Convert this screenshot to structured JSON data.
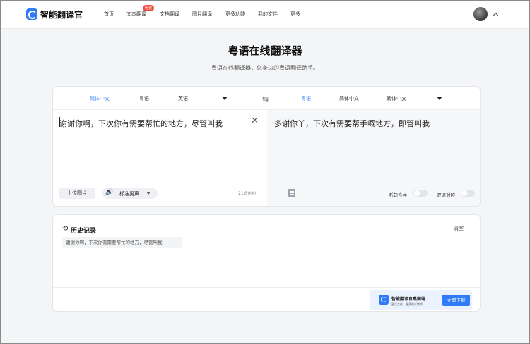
{
  "app": {
    "name": "智能翻译官"
  },
  "nav": {
    "items": [
      "首页",
      "文本翻译",
      "文档翻译",
      "图片翻译",
      "更多功能",
      "我的文件",
      "更多"
    ],
    "badge": "免费"
  },
  "hero": {
    "title": "粤语在线翻译器",
    "subtitle": "粤语在线翻译器，您身边的粤语翻译助手。"
  },
  "languages": {
    "source": [
      "简体中文",
      "粤语",
      "英语"
    ],
    "source_selected": "简体中文",
    "target": [
      "粤语",
      "简体中文",
      "繁体中文"
    ],
    "target_selected": "粤语"
  },
  "source": {
    "text": "谢谢你啊，下次你有需要帮忙的地方，尽管叫我",
    "upload_label": "上传图片",
    "voice_label": "标准男声",
    "char_count": "21/5000"
  },
  "target": {
    "text": "多谢你丫，下次有需要帮手嘅地方，即管叫我",
    "merge_label": "断句合并",
    "bilingual_label": "双语对照",
    "merge_on": false,
    "bilingual_on": false
  },
  "history": {
    "title": "历史记录",
    "clear_label": "清空",
    "items": [
      "谢谢你啊，下次你有需要帮忙的地方，尽管叫我"
    ]
  },
  "promo": {
    "title": "智能翻译官桌面端",
    "subtitle": "更大文件，更多格式转换",
    "button": "立即下载"
  },
  "colors": {
    "accent": "#2f7cf6",
    "badge": "#f04a3e"
  },
  "icons": [
    "logo-icon",
    "chevron-up-icon",
    "swap-icon",
    "clear-icon",
    "speaker-icon",
    "copy-icon",
    "history-icon"
  ]
}
